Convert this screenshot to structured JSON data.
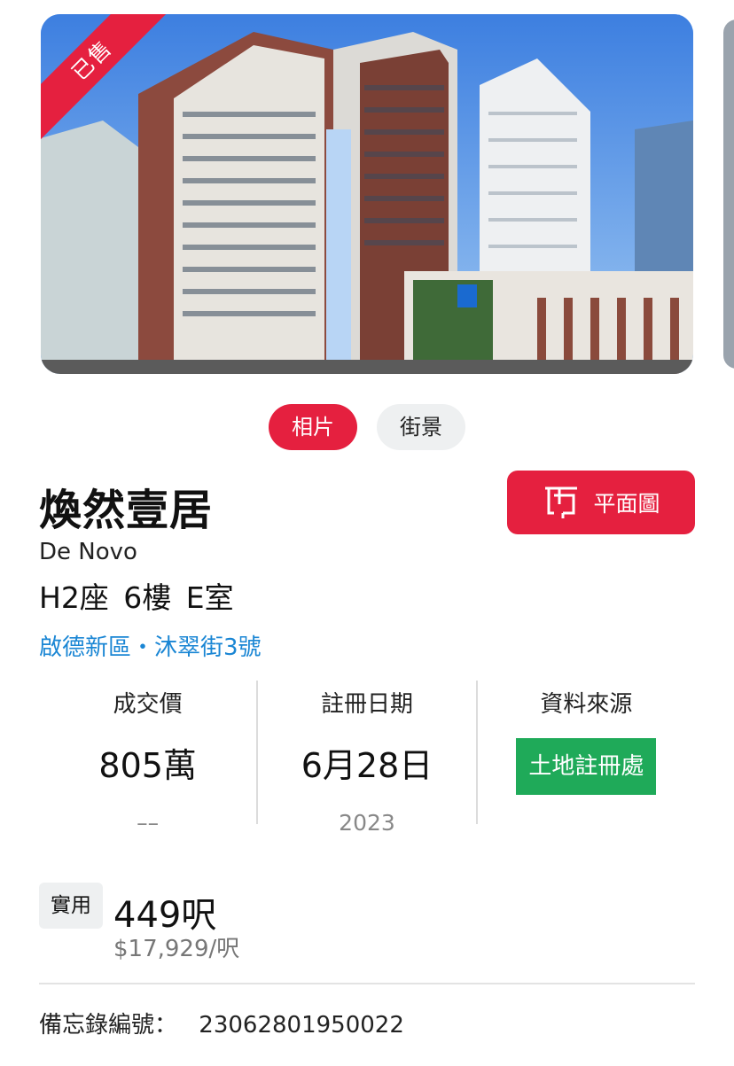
{
  "gallery": {
    "sold_label": "已售"
  },
  "tabs": [
    {
      "label": "相片",
      "active": true
    },
    {
      "label": "街景",
      "active": false
    }
  ],
  "property": {
    "name_zh": "煥然壹居",
    "name_en": "De Novo",
    "unit": "H2座 6樓 E室",
    "address": "啟德新區・沐翠街3號"
  },
  "floorplan_button": {
    "label": "平面圖",
    "icon": "floorplan-icon"
  },
  "stats": {
    "price": {
      "label": "成交價",
      "value": "805萬",
      "sub": "––"
    },
    "date": {
      "label": "註冊日期",
      "value": "6月28日",
      "sub": "2023"
    },
    "source": {
      "label": "資料來源",
      "value": "土地註冊處"
    }
  },
  "area": {
    "label": "實用",
    "value": "449呎",
    "per_sqft": "$17,929/呎"
  },
  "memo": {
    "label": "備忘錄編號：",
    "value": "23062801950022"
  },
  "colors": {
    "accent": "#e5203f",
    "link": "#1a86d4",
    "source_green": "#1faa59"
  }
}
